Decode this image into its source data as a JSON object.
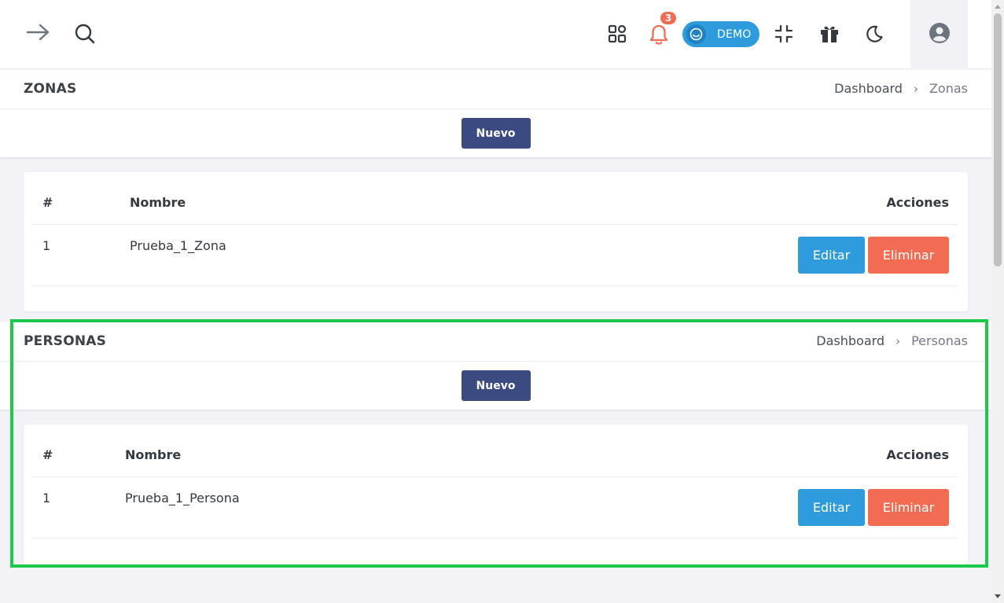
{
  "topbar": {
    "notification_count": "3",
    "demo_label": "DEMO",
    "icons": [
      "arrow-right-icon",
      "search-icon",
      "apps-grid-icon",
      "bell-icon",
      "smile-icon",
      "collapse-icon",
      "gift-icon",
      "moon-icon",
      "user-avatar-icon"
    ],
    "colors": {
      "accent": "#2e9cdc",
      "danger": "#f16c52",
      "primary": "#3b4a80",
      "highlight": "#1ec84a"
    }
  },
  "zonas": {
    "title": "ZONAS",
    "breadcrumb": {
      "home": "Dashboard",
      "current": "Zonas"
    },
    "new_label": "Nuevo",
    "columns": {
      "num": "#",
      "name": "Nombre",
      "actions": "Acciones"
    },
    "rows": [
      {
        "num": "1",
        "name": "Prueba_1_Zona",
        "edit": "Editar",
        "delete": "Eliminar"
      }
    ]
  },
  "personas": {
    "title": "PERSONAS",
    "breadcrumb": {
      "home": "Dashboard",
      "current": "Personas"
    },
    "new_label": "Nuevo",
    "columns": {
      "num": "#",
      "name": "Nombre",
      "actions": "Acciones"
    },
    "rows": [
      {
        "num": "1",
        "name": "Prueba_1_Persona",
        "edit": "Editar",
        "delete": "Eliminar"
      }
    ]
  }
}
